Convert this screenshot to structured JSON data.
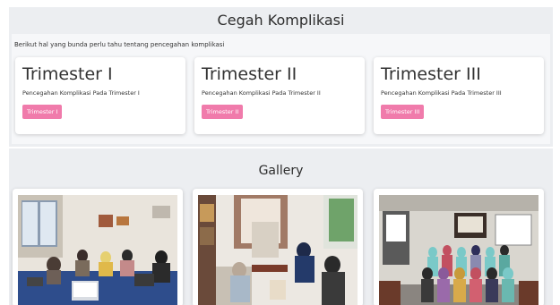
{
  "section": {
    "title": "Cegah Komplikasi",
    "intro": "Berikut hal yang bunda perlu tahu tentang pencegahan komplikasi"
  },
  "cards": [
    {
      "title": "Trimester I",
      "description": "Pencegahan Komplikasi Pada Trimester I",
      "button": "Trimester I"
    },
    {
      "title": "Trimester II",
      "description": "Pencegahan Komplikasi Pada Trimester II",
      "button": "Trimester II"
    },
    {
      "title": "Trimester III",
      "description": "Pencegahan Komplikasi Pada Trimester III",
      "button": "Trimester III"
    }
  ],
  "gallery": {
    "title": "Gallery"
  },
  "colors": {
    "accent": "#f07bab",
    "panel": "#eceef1"
  }
}
